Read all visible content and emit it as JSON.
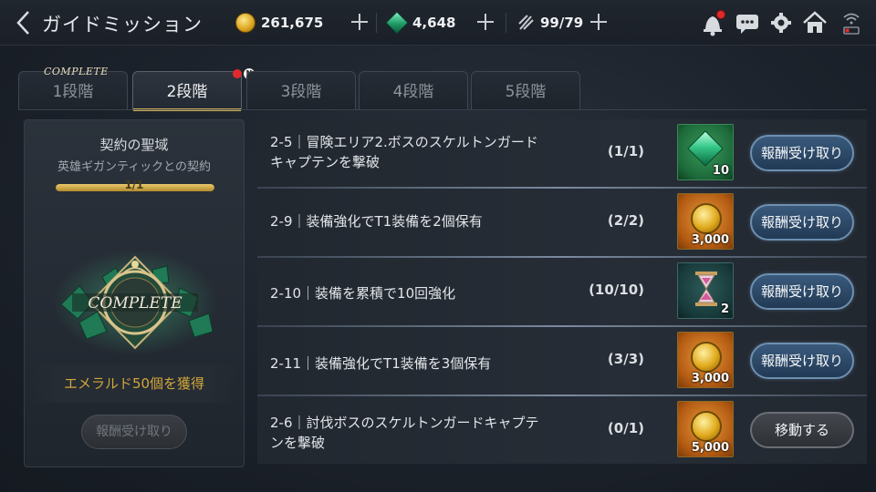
{
  "header": {
    "title": "ガイドミッション",
    "gold": "261,675",
    "gems": "4,648",
    "stamina": "99/79"
  },
  "tabs": [
    {
      "label": "1段階",
      "badge": "COMPLETE"
    },
    {
      "label": "2段階",
      "badge": "N"
    },
    {
      "label": "3段階"
    },
    {
      "label": "4段階"
    },
    {
      "label": "5段階"
    }
  ],
  "contract": {
    "title": "契約の聖域",
    "subtitle": "英雄ギガンティックとの契約",
    "progress_text": "1/1",
    "progress_fraction": 1.0,
    "emblem_text": "COMPLETE",
    "reward_text": "エメラルド50個を獲得",
    "button_label": "報酬受け取り"
  },
  "missions": [
    {
      "text": "2-5｜冒険エリア2.ボスのスケルトンガードキャプテンを撃破",
      "count": "(1/1)",
      "reward_icon": "emerald-icon",
      "reward_qty": "10",
      "button": "報酬受け取り"
    },
    {
      "text": "2-9｜装備強化でT1装備を2個保有",
      "count": "(2/2)",
      "reward_icon": "gold-coin-icon",
      "reward_qty": "3,000",
      "button": "報酬受け取り"
    },
    {
      "text": "2-10｜装備を累積で10回強化",
      "count": "(10/10)",
      "reward_icon": "hourglass-icon",
      "reward_qty": "2",
      "button": "報酬受け取り"
    },
    {
      "text": "2-11｜装備強化でT1装備を3個保有",
      "count": "(3/3)",
      "reward_icon": "gold-coin-icon",
      "reward_qty": "3,000",
      "button": "報酬受け取り"
    },
    {
      "text": "2-6｜討伐ボスのスケルトンガードキャプテンを撃破",
      "count": "(0/1)",
      "reward_icon": "gold-coin-icon",
      "reward_qty": "5,000",
      "button": "移動する"
    }
  ],
  "colors": {
    "accent_gold": "#d6b35c",
    "claim_button": "#2d4a6a",
    "move_button": "#3a3d42"
  }
}
